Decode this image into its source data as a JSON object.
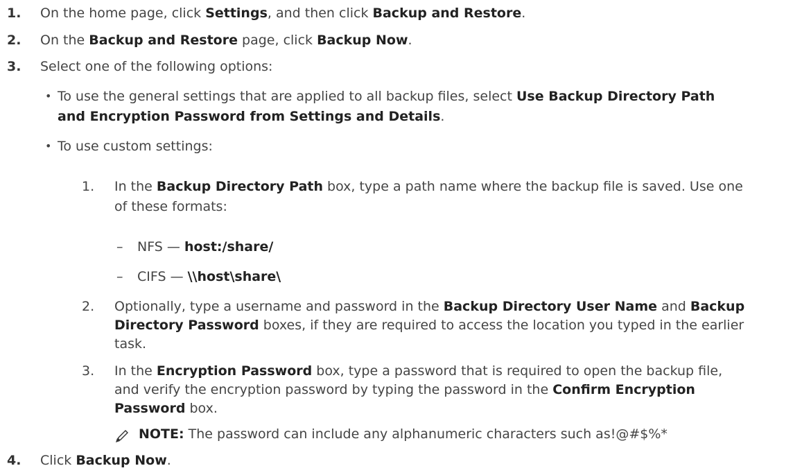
{
  "steps": {
    "s1": {
      "num": "1.",
      "a": "On the home page, click ",
      "b1": "Settings",
      "c": ", and then click ",
      "b2": "Backup and Restore",
      "d": "."
    },
    "s2": {
      "num": "2.",
      "a": "On the ",
      "b1": "Backup and Restore",
      "c": " page, click ",
      "b2": "Backup Now",
      "d": "."
    },
    "s3": {
      "num": "3.",
      "a": "Select one of the following options:"
    },
    "s4": {
      "num": "4.",
      "a": "Click ",
      "b1": "Backup Now",
      "d": "."
    }
  },
  "opt1": {
    "a": "To use the general settings that are applied to all backup files, select ",
    "b1": "Use Backup Directory Path",
    "b2": "and Encryption Password from Settings and Details",
    "d": "."
  },
  "opt2": {
    "a": "To use custom settings:",
    "sub1": {
      "num": "1.",
      "a": "In the ",
      "b1": "Backup Directory Path",
      "c": " box, type a path name where the backup file is saved. Use one",
      "line2": "of these formats:",
      "nfs": {
        "dash": "–",
        "label": "NFS — ",
        "value": "host:/share/"
      },
      "cifs": {
        "dash": "–",
        "label": "CIFS — ",
        "value": "\\\\host\\share\\"
      }
    },
    "sub2": {
      "num": "2.",
      "a": "Optionally, type a username and password in the ",
      "b1": "Backup Directory User Name",
      "c": " and ",
      "b2": "Backup",
      "b3": "Directory Password",
      "d": " boxes, if they are required to access the location you typed in the earlier",
      "line3": "task."
    },
    "sub3": {
      "num": "3.",
      "a": "In the ",
      "b1": "Encryption Password",
      "c": " box, type a password that is required to open the backup file,",
      "line2a": "and verify the encryption password by typing the password in the ",
      "line2b": "Confirm Encryption",
      "line3b": "Password",
      "line3c": " box."
    }
  },
  "note": {
    "label": "NOTE:",
    "text": " The password can include any alphanumeric characters such as!@#$%*"
  }
}
